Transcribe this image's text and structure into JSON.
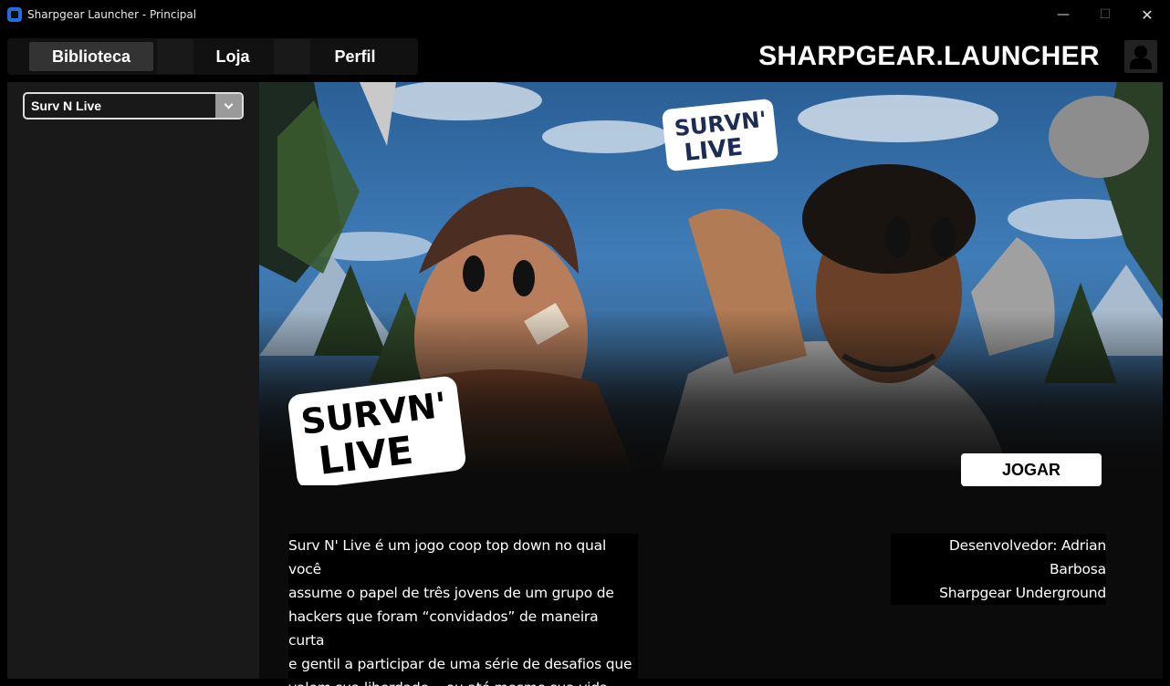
{
  "window": {
    "title": "Sharpgear Launcher - Principal",
    "minimize": "—",
    "maximize": "☐",
    "close": "✕"
  },
  "nav": {
    "tabs": [
      {
        "label": "Biblioteca",
        "active": true
      },
      {
        "label": "Loja",
        "active": false
      },
      {
        "label": "Perfil",
        "active": false
      }
    ],
    "brand": "SHARPGEAR.LAUNCHER",
    "profile_icon": "user-icon"
  },
  "sidebar": {
    "game_select": {
      "value": "Surv N Live"
    }
  },
  "game": {
    "logo_text": [
      "SURVN'",
      "LIVE"
    ],
    "play_label": "JOGAR",
    "description": "Surv N' Live é um jogo coop top down no qual você\nassume o papel de três jovens de um grupo de\nhackers que foram “convidados” de maneira curta\ne gentil a participar de uma série de desafios que\nvalem sua liberdade... ou até mesmo sua vida.",
    "developer_line": "Desenvolvedor: Adrian Barbosa",
    "studio_line": "Sharpgear Underground"
  },
  "colors": {
    "background": "#000000",
    "sidebar": "#191919",
    "active_tab": "#333333",
    "accent_icon": "#1e6fe0",
    "play_button": "#ffffff"
  }
}
